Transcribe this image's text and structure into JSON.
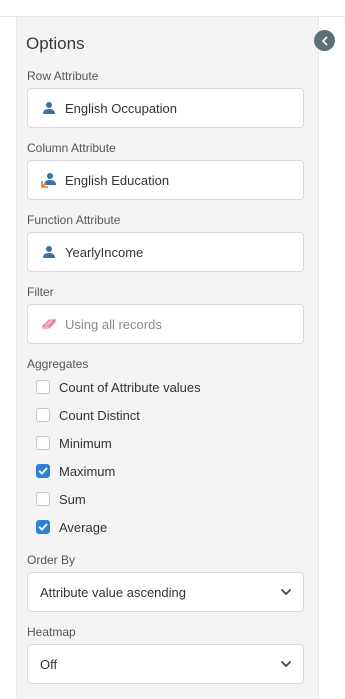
{
  "options": {
    "title": "Options",
    "row_attribute": {
      "label": "Row Attribute",
      "value": "English Occupation",
      "icon": "user-icon"
    },
    "column_attribute": {
      "label": "Column Attribute",
      "value": "English Education",
      "icon": "user-swap-icon"
    },
    "function_attribute": {
      "label": "Function Attribute",
      "value": "YearlyIncome",
      "icon": "user-icon"
    },
    "filter": {
      "label": "Filter",
      "value": "Using all records",
      "icon": "eraser-icon"
    },
    "aggregates": {
      "label": "Aggregates",
      "items": [
        {
          "label": "Count of Attribute values",
          "checked": false
        },
        {
          "label": "Count Distinct",
          "checked": false
        },
        {
          "label": "Minimum",
          "checked": false
        },
        {
          "label": "Maximum",
          "checked": true
        },
        {
          "label": "Sum",
          "checked": false
        },
        {
          "label": "Average",
          "checked": true
        }
      ]
    },
    "order_by": {
      "label": "Order By",
      "value": "Attribute value ascending"
    },
    "heatmap": {
      "label": "Heatmap",
      "value": "Off"
    }
  },
  "colors": {
    "accent": "#2f7fd4",
    "icon_blue": "#3b6fa8",
    "panel_bg": "#f4f4f4",
    "collapse_button": "#5e6f7a",
    "filter_icon": "#e07a94"
  }
}
